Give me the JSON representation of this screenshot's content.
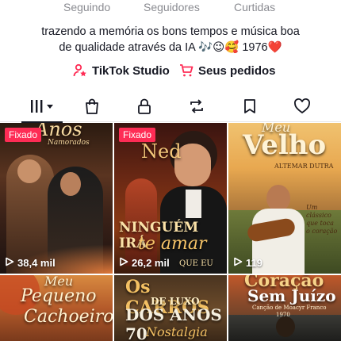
{
  "stats": {
    "following_label": "Seguindo",
    "followers_label": "Seguidores",
    "likes_label": "Curtidas"
  },
  "bio": {
    "line1": "trazendo a memória os bons tempos e música boa",
    "line2_prefix": "de qualidade através da IA 🎶😉🥰 1976",
    "heart": "❤️"
  },
  "links": {
    "studio": "TikTok Studio",
    "orders": "Seus pedidos"
  },
  "colors": {
    "accent": "#fe2c55",
    "text": "#161823",
    "muted": "#8a8b91"
  },
  "tabs": [
    {
      "icon": "grid-icon",
      "active": true
    },
    {
      "icon": "shopping-bag-icon"
    },
    {
      "icon": "lock-icon"
    },
    {
      "icon": "repost-icon"
    },
    {
      "icon": "bookmark-icon"
    },
    {
      "icon": "heart-outline-icon"
    }
  ],
  "videos": [
    {
      "pinned_label": "Fixado",
      "views": "38,4 mil",
      "poster_title": "Anos",
      "poster_sub": "Namorados"
    },
    {
      "pinned_label": "Fixado",
      "views": "26,2 mil",
      "poster_title": "Ned",
      "poster_caption": "NINGUÉM IRÁ",
      "poster_caption2": "te amar",
      "poster_caption3": "QUE EU"
    },
    {
      "views": "119",
      "poster_title": "Velho",
      "poster_top": "Meu",
      "poster_sub": "ALTEMAR DUTRA",
      "poster_caption": "Um clássico que toca o coração"
    },
    {
      "poster_top": "Meu",
      "poster_title": "Pequeno",
      "poster_sub": "Cachoeiro"
    },
    {
      "poster_title": "Os CARROS",
      "poster_sub": "DE LUXO",
      "poster_caption": "DOS ANOS 70",
      "poster_caption2": "Nostalgia"
    },
    {
      "poster_title": "Coração",
      "poster_sub": "Sem Juízo",
      "poster_caption": "Canção de Moacyr Franco",
      "poster_caption2": "1970"
    }
  ]
}
